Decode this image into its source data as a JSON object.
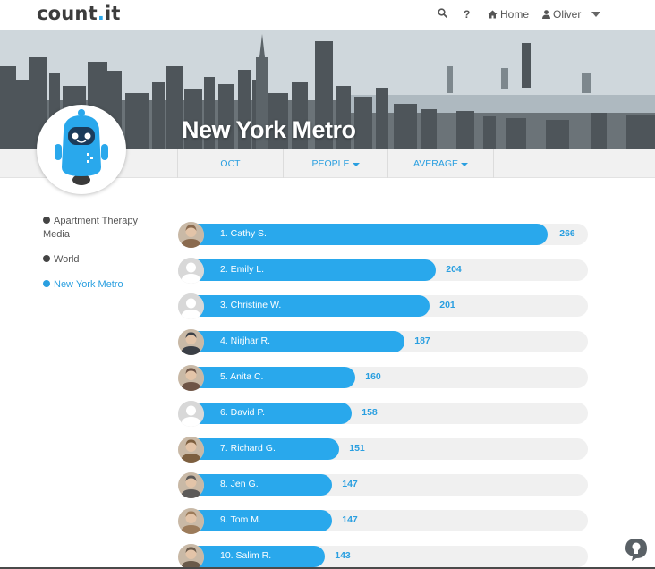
{
  "app": {
    "logo_main": "count",
    "logo_dot": ".",
    "logo_suffix": "it"
  },
  "nav": {
    "help": "?",
    "home": "Home",
    "user": "Oliver"
  },
  "banner": {
    "title": "New York Metro"
  },
  "subnav": {
    "tabs": [
      {
        "label": "OCT",
        "dropdown": false
      },
      {
        "label": "PEOPLE",
        "dropdown": true
      },
      {
        "label": "AVERAGE",
        "dropdown": true
      }
    ]
  },
  "sidebar": {
    "items": [
      {
        "label": "Apartment Therapy Media",
        "active": false
      },
      {
        "label": "World",
        "active": false
      },
      {
        "label": "New York Metro",
        "active": true
      }
    ]
  },
  "leaderboard": {
    "max_score": 266,
    "rows": [
      {
        "name": "1. Cathy S.",
        "score": "266",
        "avatar": "photo"
      },
      {
        "name": "2. Emily L.",
        "score": "204",
        "avatar": "default"
      },
      {
        "name": "3. Christine W.",
        "score": "201",
        "avatar": "default"
      },
      {
        "name": "4. Nirjhar R.",
        "score": "187",
        "avatar": "photo"
      },
      {
        "name": "5. Anita C.",
        "score": "160",
        "avatar": "photo"
      },
      {
        "name": "6. David P.",
        "score": "158",
        "avatar": "default"
      },
      {
        "name": "7. Richard G.",
        "score": "151",
        "avatar": "photo"
      },
      {
        "name": "8. Jen G.",
        "score": "147",
        "avatar": "photo"
      },
      {
        "name": "9. Tom M.",
        "score": "147",
        "avatar": "photo"
      },
      {
        "name": "10. Salim R.",
        "score": "143",
        "avatar": "photo"
      }
    ]
  },
  "colors": {
    "accent": "#29a8ec",
    "track": "#f0f0f0",
    "text": "#555555"
  },
  "icons": {
    "search": "search-icon",
    "help": "question-icon",
    "home": "home-icon",
    "user": "user-icon",
    "caret": "caret-down-icon",
    "support": "lightbulb-chat-icon"
  }
}
